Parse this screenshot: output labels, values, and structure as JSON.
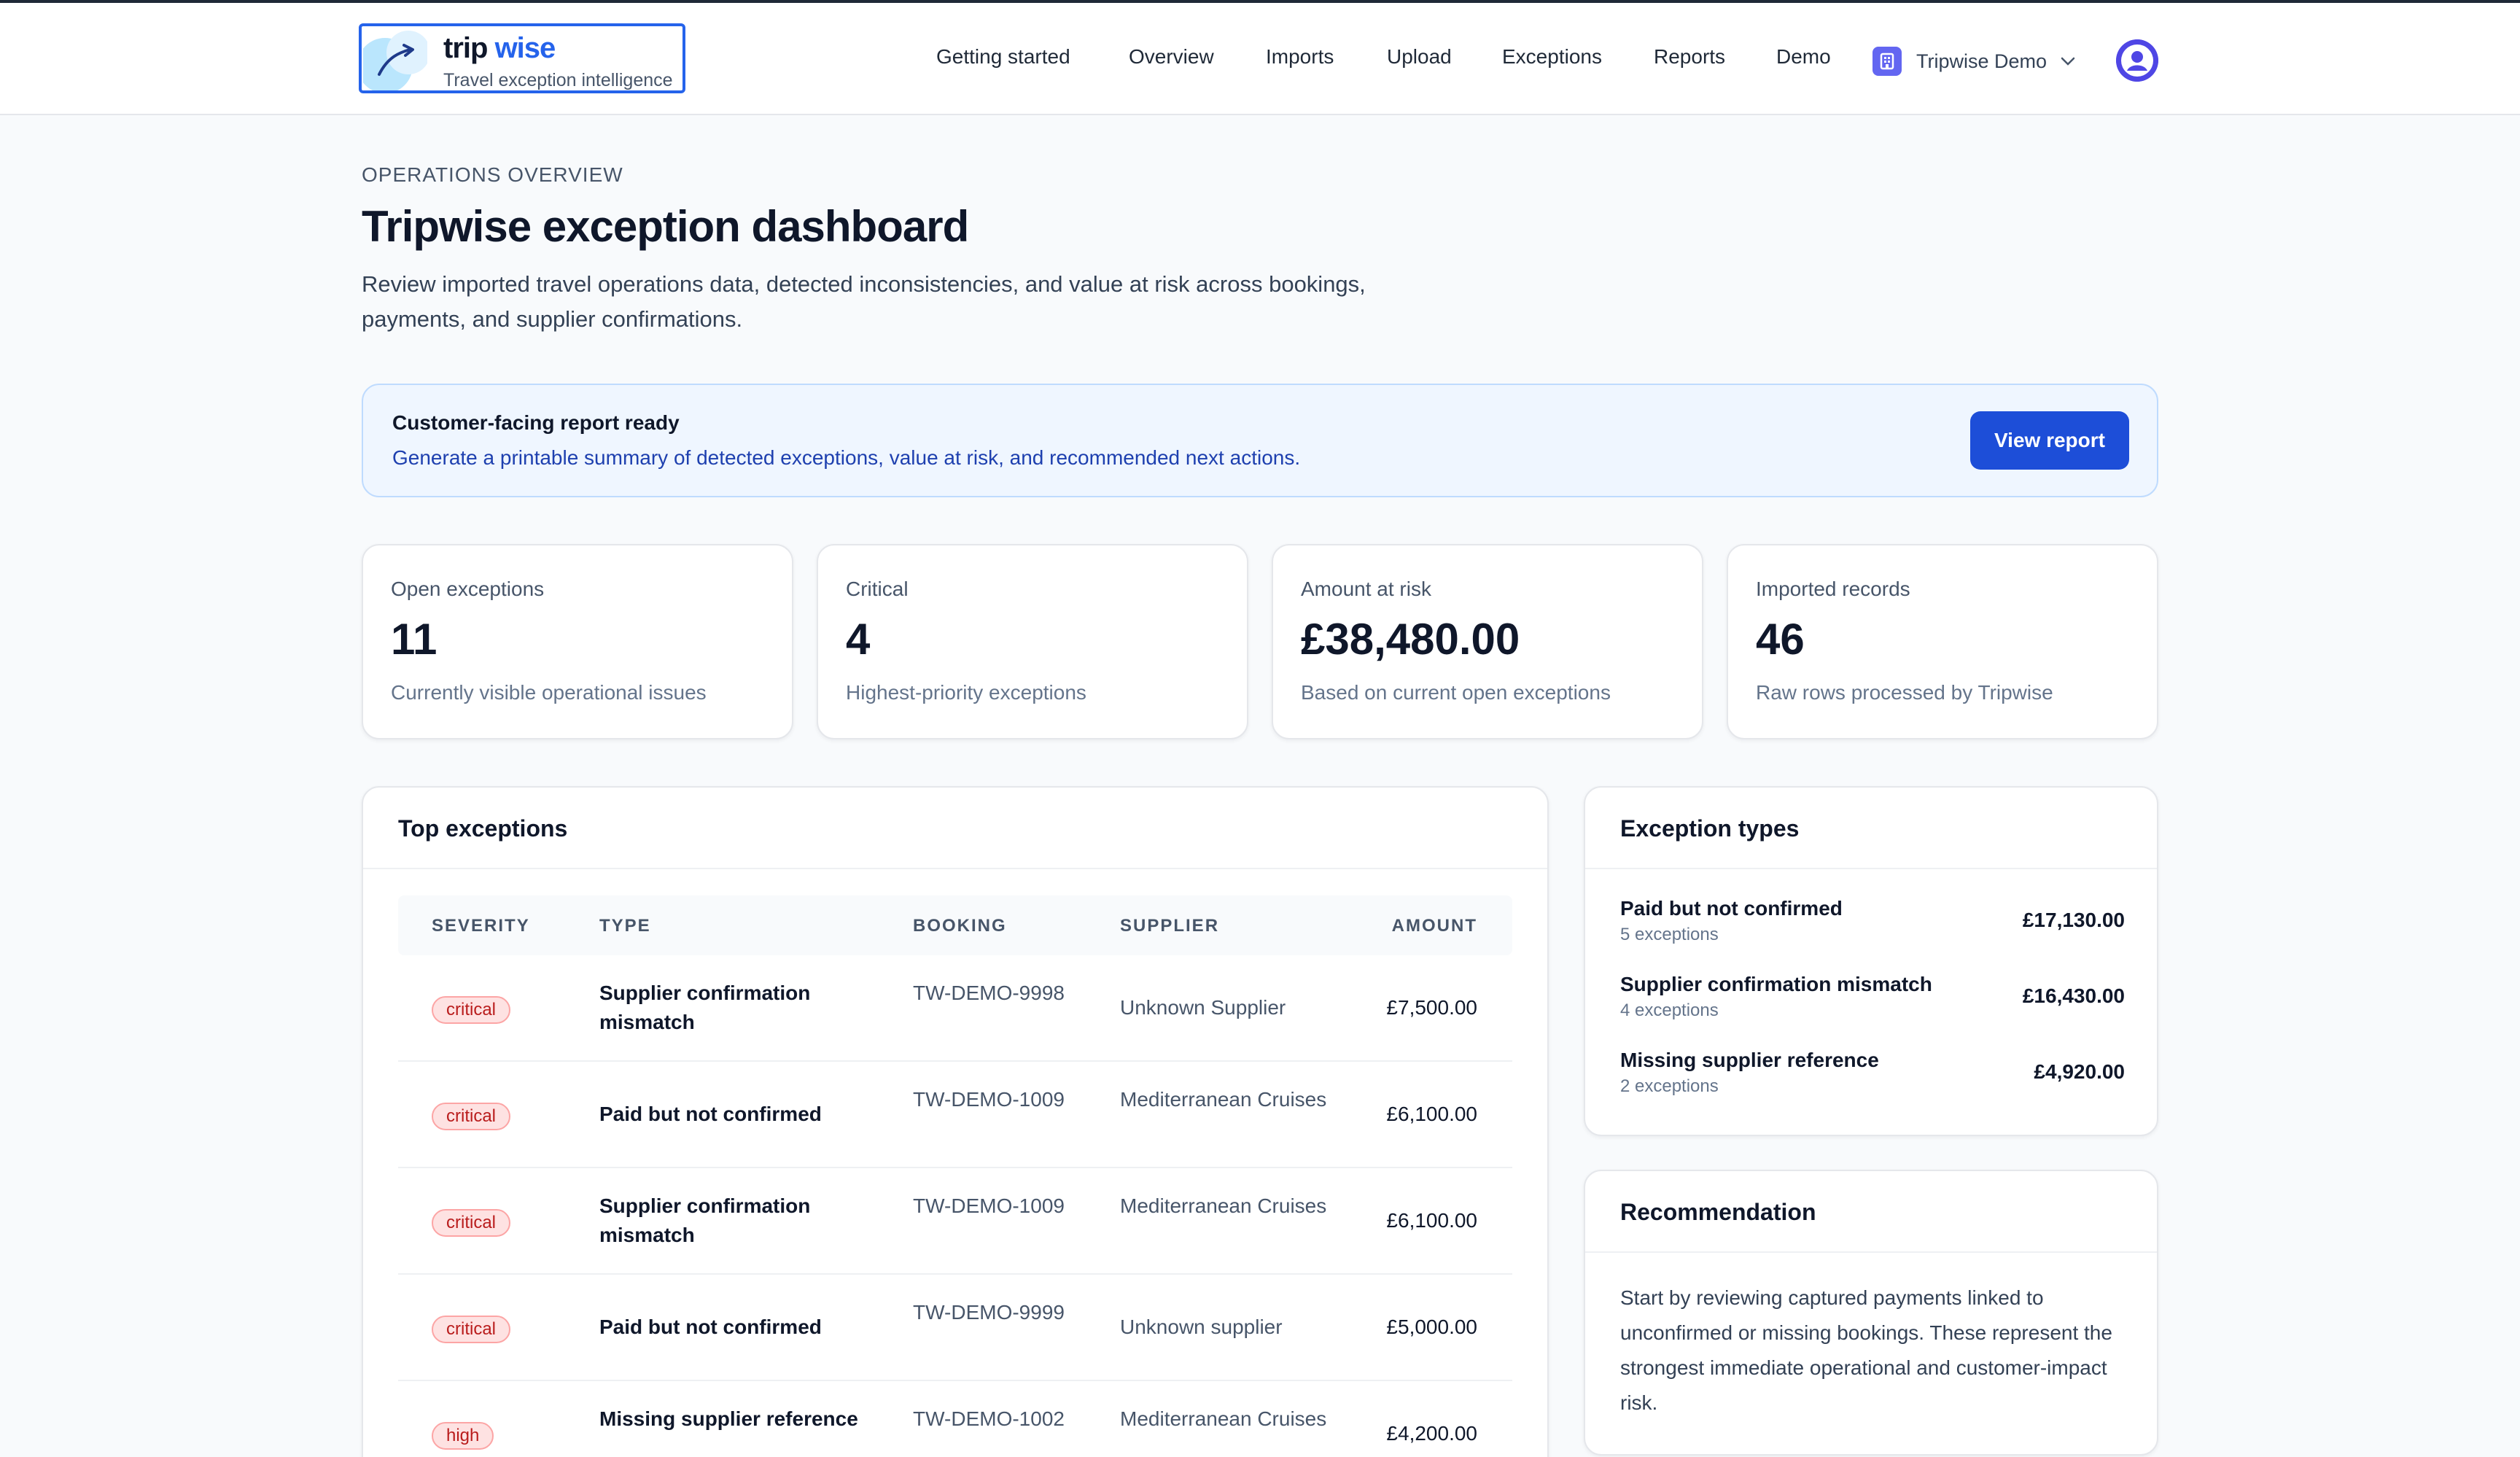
{
  "brand": {
    "name_part1": "trip",
    "name_part2": "wise",
    "tagline": "Travel exception intelligence",
    "accent_color": "#2563eb"
  },
  "nav": {
    "items": [
      "Getting started",
      "Overview",
      "Imports",
      "Upload",
      "Exceptions",
      "Reports",
      "Demo"
    ],
    "org_label": "Tripwise Demo",
    "org_icon": "building-icon",
    "avatar_icon": "user-icon"
  },
  "page": {
    "eyebrow": "OPERATIONS OVERVIEW",
    "title": "Tripwise exception dashboard",
    "description": "Review imported travel operations data, detected inconsistencies, and value at risk across bookings, payments, and supplier confirmations."
  },
  "banner": {
    "title": "Customer-facing report ready",
    "text": "Generate a printable summary of detected exceptions, value at risk, and recommended next actions.",
    "button": "View report"
  },
  "stats": [
    {
      "label": "Open exceptions",
      "value": "11",
      "note": "Currently visible operational issues"
    },
    {
      "label": "Critical",
      "value": "4",
      "note": "Highest-priority exceptions"
    },
    {
      "label": "Amount at risk",
      "value": "£38,480.00",
      "note": "Based on current open exceptions"
    },
    {
      "label": "Imported records",
      "value": "46",
      "note": "Raw rows processed by Tripwise"
    }
  ],
  "top_exceptions": {
    "title": "Top exceptions",
    "columns": [
      "SEVERITY",
      "TYPE",
      "BOOKING",
      "SUPPLIER",
      "AMOUNT"
    ],
    "rows": [
      {
        "severity": "critical",
        "type": "Supplier confirmation mismatch",
        "booking": "TW-DEMO-9998",
        "supplier": "Unknown Supplier",
        "amount": "£7,500.00"
      },
      {
        "severity": "critical",
        "type": "Paid but not confirmed",
        "booking": "TW-DEMO-1009",
        "supplier": "Mediterranean Cruises",
        "amount": "£6,100.00"
      },
      {
        "severity": "critical",
        "type": "Supplier confirmation mismatch",
        "booking": "TW-DEMO-1009",
        "supplier": "Mediterranean Cruises",
        "amount": "£6,100.00"
      },
      {
        "severity": "critical",
        "type": "Paid but not confirmed",
        "booking": "TW-DEMO-9999",
        "supplier": "Unknown supplier",
        "amount": "£5,000.00"
      },
      {
        "severity": "high",
        "type": "Missing supplier reference",
        "booking": "TW-DEMO-1002",
        "supplier": "Mediterranean Cruises",
        "amount": "£4,200.00"
      }
    ]
  },
  "exception_types": {
    "title": "Exception types",
    "items": [
      {
        "name": "Paid but not confirmed",
        "count": "5 exceptions",
        "amount": "£17,130.00"
      },
      {
        "name": "Supplier confirmation mismatch",
        "count": "4 exceptions",
        "amount": "£16,430.00"
      },
      {
        "name": "Missing supplier reference",
        "count": "2 exceptions",
        "amount": "£4,920.00"
      }
    ]
  },
  "recommendation": {
    "title": "Recommendation",
    "text": "Start by reviewing captured payments linked to unconfirmed or missing bookings. These represent the strongest immediate operational and customer-impact risk."
  }
}
